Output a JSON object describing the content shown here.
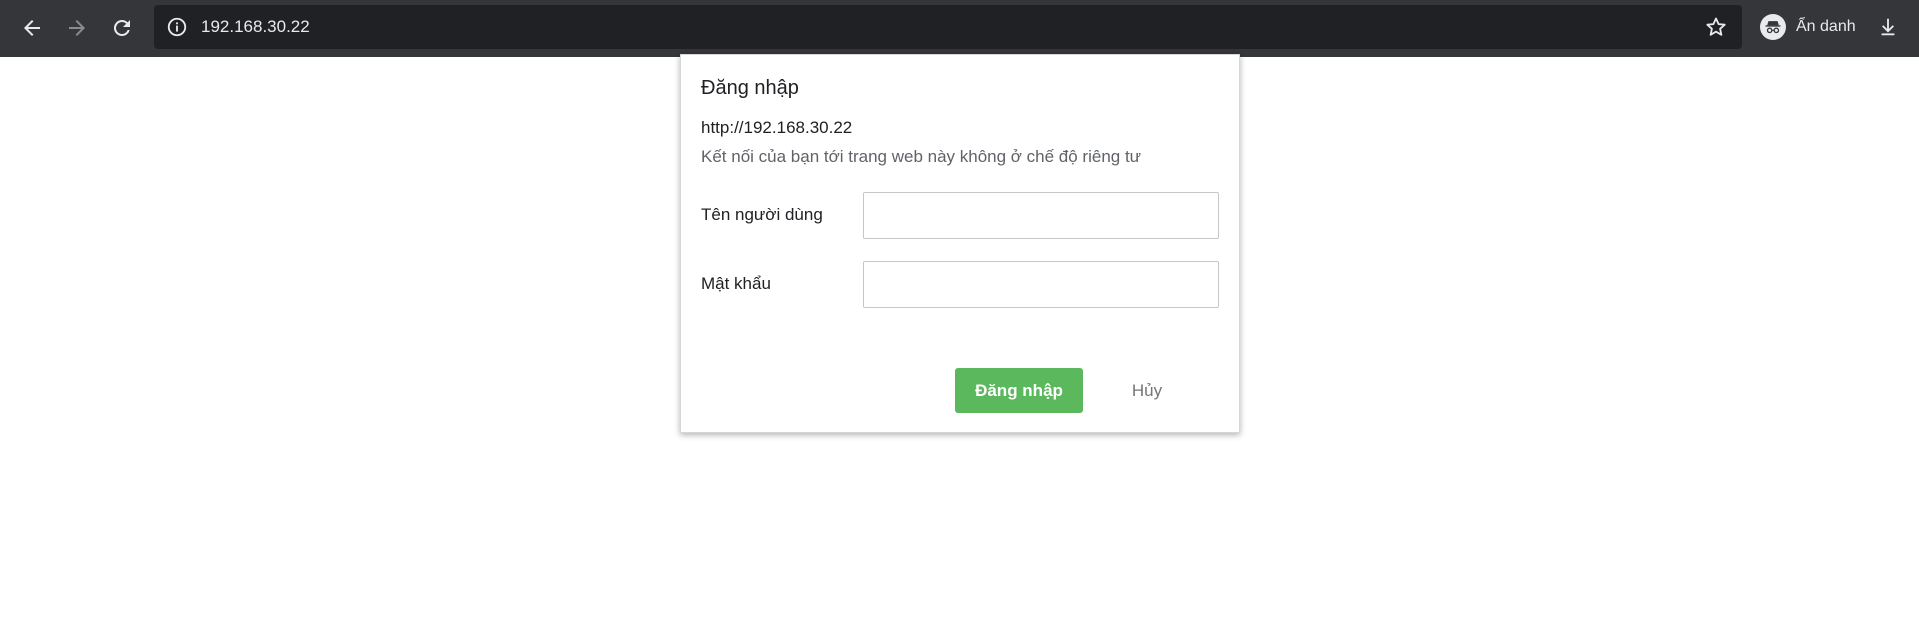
{
  "browser": {
    "url": "192.168.30.22",
    "profile_label": "Ẩn danh",
    "icons": {
      "back": "arrow-left-icon",
      "forward": "arrow-right-icon",
      "reload": "reload-icon",
      "site_info": "info-icon",
      "bookmark": "star-icon",
      "profile": "incognito-icon",
      "download": "download-icon"
    },
    "colors": {
      "toolbar": "#35363a",
      "omnibox": "#202124"
    }
  },
  "dialog": {
    "title": "Đăng nhập",
    "origin": "http://192.168.30.22",
    "warning": "Kết nối của bạn tới trang web này không ở chế độ riêng tư",
    "username_label": "Tên người dùng",
    "username_value": "",
    "password_label": "Mật khẩu",
    "password_value": "",
    "login_button": "Đăng nhập",
    "cancel_button": "Hủy",
    "colors": {
      "login_button": "#5cb85c"
    }
  }
}
